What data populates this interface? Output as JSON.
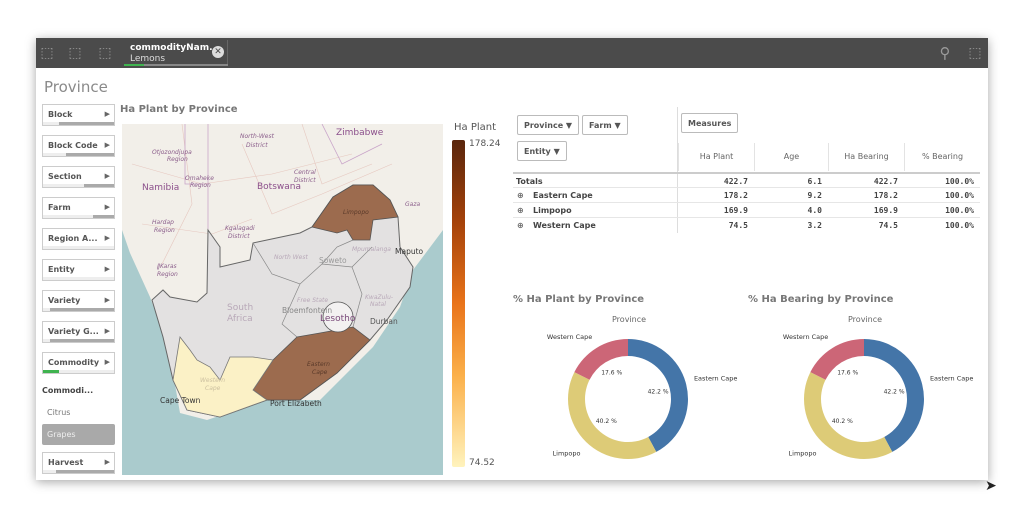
{
  "toolbar": {
    "selection": {
      "field": "commodityNam...",
      "value": "Lemons"
    },
    "icons": [
      "smart-search-back-icon",
      "step-forward-icon",
      "clear-selections-icon",
      "search-icon",
      "selections-tool-icon"
    ]
  },
  "sheet_title": "Province",
  "filters": [
    {
      "label": "Block"
    },
    {
      "label": "Block Code"
    },
    {
      "label": "Section"
    },
    {
      "label": "Farm"
    },
    {
      "label": "Region A..."
    },
    {
      "label": "Entity"
    },
    {
      "label": "Variety"
    },
    {
      "label": "Variety G..."
    },
    {
      "label": "Commodity"
    }
  ],
  "commodity_list": {
    "title": "Commodi...",
    "items": [
      "Citrus",
      "Grapes"
    ],
    "selected": "Grapes"
  },
  "harvest_filter": {
    "label": "Harvest"
  },
  "map": {
    "title": "Ha Plant by Province",
    "legend_title": "Ha Plant",
    "legend_max": "178.24",
    "legend_min": "74.52",
    "labels": {
      "zimbabwe": "Zimbabwe",
      "namibia": "Namibia",
      "botswana": "Botswana",
      "south_africa_1": "South",
      "south_africa_2": "Africa",
      "northwest_district_1": "North-West",
      "northwest_district_2": "District",
      "otjozondjupa_1": "Otjozondjupa",
      "otjozondjupa_2": "Region",
      "omaheke_1": "Omaheke",
      "omaheke_2": "Region",
      "central_1": "Central",
      "central_2": "District",
      "hardap_1": "Hardap",
      "hardap_2": "Region",
      "kgalagadi_1": "Kgalagadi",
      "kgalagadi_2": "District",
      "karas_1": "ǁKaras",
      "karas_2": "Region",
      "gaza": "Gaza",
      "limpopo": "Limpopo",
      "maputo": "Maputo",
      "north_west": "North West",
      "soweto": "Soweto",
      "mpumalanga": "Mpumalanga",
      "free_state": "Free State",
      "bloemfontein": "Bloemfontein",
      "lesotho": "Lesotho",
      "kzn_1": "KwaZulu-",
      "kzn_2": "Natal",
      "durban": "Durban",
      "eastern_cape_1": "Eastern",
      "eastern_cape_2": "Cape",
      "western_cape_1": "Western",
      "western_cape_2": "Cape",
      "cape_town": "Cape Town",
      "port_elizabeth": "Port Elizabeth"
    },
    "colors": {
      "eastern_cape": "#9c6b4e",
      "limpopo": "#9c6b4e",
      "western_cape": "#fbf1c6",
      "other": "#e3e1e1",
      "ocean": "#aacbcd",
      "land": "#f2efe9"
    }
  },
  "pivot": {
    "dimensions": [
      "Province",
      "Farm",
      "Entity"
    ],
    "measures_button": "Measures",
    "columns": [
      "Ha Plant",
      "Age",
      "Ha Bearing",
      "% Bearing"
    ],
    "rows": [
      {
        "label": "Totals",
        "values": [
          "422.7",
          "6.1",
          "422.7",
          "100.0%"
        ]
      },
      {
        "label": "Eastern Cape",
        "values": [
          "178.2",
          "9.2",
          "178.2",
          "100.0%"
        ]
      },
      {
        "label": "Limpopo",
        "values": [
          "169.9",
          "4.0",
          "169.9",
          "100.0%"
        ]
      },
      {
        "label": "Western Cape",
        "values": [
          "74.5",
          "3.2",
          "74.5",
          "100.0%"
        ]
      }
    ]
  },
  "chart_data": [
    {
      "type": "pie",
      "title": "% Ha Plant by Province",
      "subtitle": "Province",
      "categories": [
        "Eastern Cape",
        "Limpopo",
        "Western Cape"
      ],
      "values": [
        42.2,
        40.2,
        17.6
      ],
      "labels": [
        "42.2 %",
        "40.2 %",
        "17.6 %"
      ],
      "colors": [
        "#4475a8",
        "#ddcb77",
        "#cc6677"
      ],
      "donut": true
    },
    {
      "type": "pie",
      "title": "% Ha Bearing by Province",
      "subtitle": "Province",
      "categories": [
        "Eastern Cape",
        "Limpopo",
        "Western Cape"
      ],
      "values": [
        42.2,
        40.2,
        17.6
      ],
      "labels": [
        "42.2 %",
        "40.2 %",
        "17.6 %"
      ],
      "colors": [
        "#4475a8",
        "#ddcb77",
        "#cc6677"
      ],
      "donut": true
    }
  ]
}
